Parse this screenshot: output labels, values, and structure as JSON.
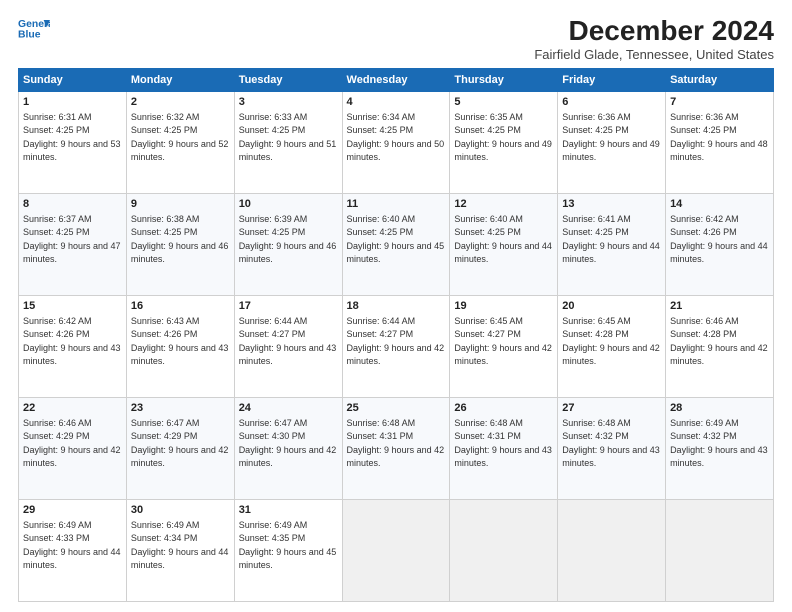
{
  "logo": {
    "line1": "General",
    "line2": "Blue"
  },
  "title": "December 2024",
  "subtitle": "Fairfield Glade, Tennessee, United States",
  "weekdays": [
    "Sunday",
    "Monday",
    "Tuesday",
    "Wednesday",
    "Thursday",
    "Friday",
    "Saturday"
  ],
  "weeks": [
    [
      {
        "day": 1,
        "sunrise": "6:31 AM",
        "sunset": "4:25 PM",
        "daylight": "9 hours and 53 minutes."
      },
      {
        "day": 2,
        "sunrise": "6:32 AM",
        "sunset": "4:25 PM",
        "daylight": "9 hours and 52 minutes."
      },
      {
        "day": 3,
        "sunrise": "6:33 AM",
        "sunset": "4:25 PM",
        "daylight": "9 hours and 51 minutes."
      },
      {
        "day": 4,
        "sunrise": "6:34 AM",
        "sunset": "4:25 PM",
        "daylight": "9 hours and 50 minutes."
      },
      {
        "day": 5,
        "sunrise": "6:35 AM",
        "sunset": "4:25 PM",
        "daylight": "9 hours and 49 minutes."
      },
      {
        "day": 6,
        "sunrise": "6:36 AM",
        "sunset": "4:25 PM",
        "daylight": "9 hours and 49 minutes."
      },
      {
        "day": 7,
        "sunrise": "6:36 AM",
        "sunset": "4:25 PM",
        "daylight": "9 hours and 48 minutes."
      }
    ],
    [
      {
        "day": 8,
        "sunrise": "6:37 AM",
        "sunset": "4:25 PM",
        "daylight": "9 hours and 47 minutes."
      },
      {
        "day": 9,
        "sunrise": "6:38 AM",
        "sunset": "4:25 PM",
        "daylight": "9 hours and 46 minutes."
      },
      {
        "day": 10,
        "sunrise": "6:39 AM",
        "sunset": "4:25 PM",
        "daylight": "9 hours and 46 minutes."
      },
      {
        "day": 11,
        "sunrise": "6:40 AM",
        "sunset": "4:25 PM",
        "daylight": "9 hours and 45 minutes."
      },
      {
        "day": 12,
        "sunrise": "6:40 AM",
        "sunset": "4:25 PM",
        "daylight": "9 hours and 44 minutes."
      },
      {
        "day": 13,
        "sunrise": "6:41 AM",
        "sunset": "4:25 PM",
        "daylight": "9 hours and 44 minutes."
      },
      {
        "day": 14,
        "sunrise": "6:42 AM",
        "sunset": "4:26 PM",
        "daylight": "9 hours and 44 minutes."
      }
    ],
    [
      {
        "day": 15,
        "sunrise": "6:42 AM",
        "sunset": "4:26 PM",
        "daylight": "9 hours and 43 minutes."
      },
      {
        "day": 16,
        "sunrise": "6:43 AM",
        "sunset": "4:26 PM",
        "daylight": "9 hours and 43 minutes."
      },
      {
        "day": 17,
        "sunrise": "6:44 AM",
        "sunset": "4:27 PM",
        "daylight": "9 hours and 43 minutes."
      },
      {
        "day": 18,
        "sunrise": "6:44 AM",
        "sunset": "4:27 PM",
        "daylight": "9 hours and 42 minutes."
      },
      {
        "day": 19,
        "sunrise": "6:45 AM",
        "sunset": "4:27 PM",
        "daylight": "9 hours and 42 minutes."
      },
      {
        "day": 20,
        "sunrise": "6:45 AM",
        "sunset": "4:28 PM",
        "daylight": "9 hours and 42 minutes."
      },
      {
        "day": 21,
        "sunrise": "6:46 AM",
        "sunset": "4:28 PM",
        "daylight": "9 hours and 42 minutes."
      }
    ],
    [
      {
        "day": 22,
        "sunrise": "6:46 AM",
        "sunset": "4:29 PM",
        "daylight": "9 hours and 42 minutes."
      },
      {
        "day": 23,
        "sunrise": "6:47 AM",
        "sunset": "4:29 PM",
        "daylight": "9 hours and 42 minutes."
      },
      {
        "day": 24,
        "sunrise": "6:47 AM",
        "sunset": "4:30 PM",
        "daylight": "9 hours and 42 minutes."
      },
      {
        "day": 25,
        "sunrise": "6:48 AM",
        "sunset": "4:31 PM",
        "daylight": "9 hours and 42 minutes."
      },
      {
        "day": 26,
        "sunrise": "6:48 AM",
        "sunset": "4:31 PM",
        "daylight": "9 hours and 43 minutes."
      },
      {
        "day": 27,
        "sunrise": "6:48 AM",
        "sunset": "4:32 PM",
        "daylight": "9 hours and 43 minutes."
      },
      {
        "day": 28,
        "sunrise": "6:49 AM",
        "sunset": "4:32 PM",
        "daylight": "9 hours and 43 minutes."
      }
    ],
    [
      {
        "day": 29,
        "sunrise": "6:49 AM",
        "sunset": "4:33 PM",
        "daylight": "9 hours and 44 minutes."
      },
      {
        "day": 30,
        "sunrise": "6:49 AM",
        "sunset": "4:34 PM",
        "daylight": "9 hours and 44 minutes."
      },
      {
        "day": 31,
        "sunrise": "6:49 AM",
        "sunset": "4:35 PM",
        "daylight": "9 hours and 45 minutes."
      },
      null,
      null,
      null,
      null
    ]
  ]
}
